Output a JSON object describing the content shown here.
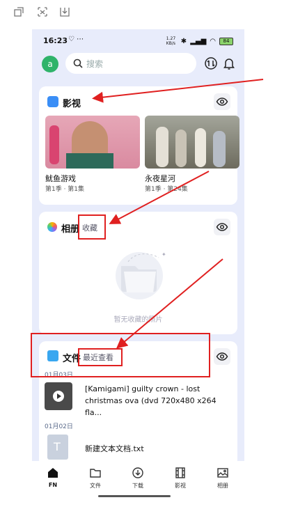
{
  "status_bar": {
    "time": "16:23",
    "icons": [
      "heart-person-icon",
      "more-dots-icon"
    ],
    "right_text": "1.27 KB/s",
    "battery": "84"
  },
  "top_bar": {
    "avatar_letter": "a",
    "search_placeholder": "搜索"
  },
  "video_card": {
    "title": "影视",
    "items": [
      {
        "name": "鱿鱼游戏",
        "sub": "第1季 · 第1集"
      },
      {
        "name": "永夜星河",
        "sub": "第1季 · 第24集"
      }
    ]
  },
  "album_card": {
    "title": "相册",
    "tab": "收藏",
    "empty_text": "暂无收藏的照片"
  },
  "files_card": {
    "title": "文件",
    "tab": "最近查看",
    "groups": [
      {
        "date": "01月03日",
        "file": "[Kamigami] guilty crown - lost christmas ova (dvd 720x480 x264 fla..."
      },
      {
        "date": "01月02日",
        "file": "新建文本文档.txt"
      }
    ]
  },
  "bottom_nav": [
    {
      "label": "FN",
      "icon": "home-icon"
    },
    {
      "label": "文件",
      "icon": "folder-icon"
    },
    {
      "label": "下载",
      "icon": "download-icon"
    },
    {
      "label": "影视",
      "icon": "film-icon"
    },
    {
      "label": "相册",
      "icon": "image-icon"
    }
  ],
  "colors": {
    "annotation_red": "#e02020",
    "accent_green": "#2fb36a",
    "phone_bg": "#e8ecfb"
  }
}
